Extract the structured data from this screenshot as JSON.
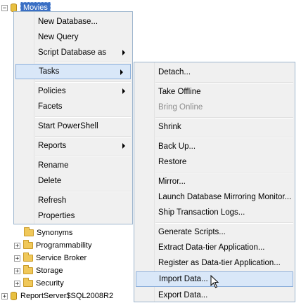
{
  "tree": {
    "root_db": "Movies",
    "items": [
      {
        "label": "Synonyms",
        "expander": ""
      },
      {
        "label": "Programmability",
        "expander": "+"
      },
      {
        "label": "Service Broker",
        "expander": "+"
      },
      {
        "label": "Storage",
        "expander": "+"
      },
      {
        "label": "Security",
        "expander": "+"
      }
    ],
    "server": {
      "label": "ReportServer$SQL2008R2",
      "expander": "+"
    }
  },
  "context_menu": {
    "items": [
      {
        "label": "New Database..."
      },
      {
        "label": "New Query"
      },
      {
        "label": "Script Database as",
        "submenu": true
      },
      {
        "label": "Tasks",
        "submenu": true,
        "highlighted": true
      },
      {
        "label": "Policies",
        "submenu": true
      },
      {
        "label": "Facets"
      },
      {
        "label": "Start PowerShell"
      },
      {
        "label": "Reports",
        "submenu": true
      },
      {
        "label": "Rename"
      },
      {
        "label": "Delete"
      },
      {
        "label": "Refresh"
      },
      {
        "label": "Properties"
      }
    ]
  },
  "tasks_submenu": {
    "items": [
      {
        "label": "Detach..."
      },
      {
        "label": "Take Offline"
      },
      {
        "label": "Bring Online",
        "disabled": true
      },
      {
        "label": "Shrink"
      },
      {
        "label": "Back Up..."
      },
      {
        "label": "Restore"
      },
      {
        "label": "Mirror..."
      },
      {
        "label": "Launch Database Mirroring Monitor..."
      },
      {
        "label": "Ship Transaction Logs..."
      },
      {
        "label": "Generate Scripts..."
      },
      {
        "label": "Extract Data-tier Application..."
      },
      {
        "label": "Register as Data-tier Application..."
      },
      {
        "label": "Import Data...",
        "highlighted": true
      },
      {
        "label": "Export Data..."
      }
    ]
  },
  "colors": {
    "selection": "#3a6fc4",
    "menu_hover": "#d9e7f8",
    "menu_hover_border": "#8db0db",
    "menu_border": "#9eb6ce"
  }
}
